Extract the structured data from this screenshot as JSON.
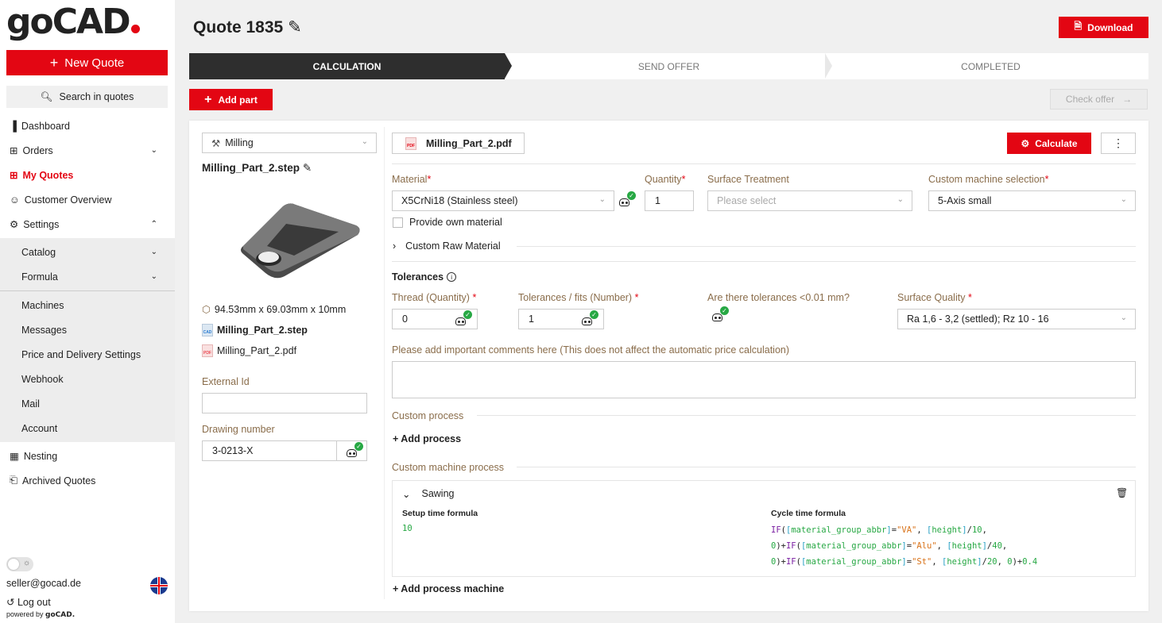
{
  "sidebar": {
    "logo": "goCAD",
    "new_quote": "New Quote",
    "search": "Search in quotes",
    "items": [
      {
        "label": "Dashboard"
      },
      {
        "label": "Orders"
      },
      {
        "label": "My Quotes"
      },
      {
        "label": "Customer Overview"
      },
      {
        "label": "Settings"
      },
      {
        "label": "Catalog"
      },
      {
        "label": "Formula"
      },
      {
        "label": "Machines"
      },
      {
        "label": "Messages"
      },
      {
        "label": "Price and Delivery Settings"
      },
      {
        "label": "Webhook"
      },
      {
        "label": "Mail"
      },
      {
        "label": "Account"
      },
      {
        "label": "Nesting"
      },
      {
        "label": "Archived Quotes"
      }
    ],
    "email": "seller@gocad.de",
    "logout": "Log out",
    "powered_prefix": "powered by",
    "powered_brand": "goCAD."
  },
  "header": {
    "title": "Quote 1835",
    "download": "Download"
  },
  "steps": [
    "CALCULATION",
    "SEND OFFER",
    "COMPLETED"
  ],
  "toolbar": {
    "add_part": "Add part",
    "check_offer": "Check offer"
  },
  "part": {
    "process": "Milling",
    "filename": "Milling_Part_2.step",
    "dimensions": "94.53mm x 69.03mm x 10mm",
    "files": [
      "Milling_Part_2.step",
      "Milling_Part_2.pdf"
    ],
    "external_id_label": "External Id",
    "external_id_value": "",
    "drawing_number_label": "Drawing number",
    "drawing_number_value": "3-0213-X"
  },
  "main": {
    "pdf_tab": "Milling_Part_2.pdf",
    "calculate": "Calculate",
    "material_label": "Material",
    "material_value": "X5CrNi18 (Stainless steel)",
    "quantity_label": "Quantity",
    "quantity_value": "1",
    "surface_treatment_label": "Surface Treatment",
    "surface_treatment_placeholder": "Please select",
    "machine_label": "Custom machine selection",
    "machine_value": "5-Axis small",
    "own_material": "Provide own material",
    "custom_raw": "Custom Raw Material",
    "tolerances": "Tolerances",
    "thread_label": "Thread (Quantity)",
    "thread_value": "0",
    "fits_label": "Tolerances / fits (Number)",
    "fits_value": "1",
    "small_tol_label": "Are there tolerances <0.01 mm?",
    "surface_quality_label": "Surface Quality",
    "surface_quality_value": "Ra 1,6 - 3,2 (settled); Rz 10 - 16",
    "comments_label": "Please add important comments here (This does not affect the automatic price calculation)",
    "custom_process": "Custom process",
    "add_process": "+ Add process",
    "custom_machine_process": "Custom machine process",
    "sawing": "Sawing",
    "setup_label": "Setup time formula",
    "setup_value": "10",
    "cycle_label": "Cycle time formula",
    "add_process_machine": "+ Add process machine"
  },
  "colors": {
    "accent": "#e30613",
    "dark": "#2e2e2e",
    "ok": "#27a844",
    "label": "#8a6d4b"
  }
}
